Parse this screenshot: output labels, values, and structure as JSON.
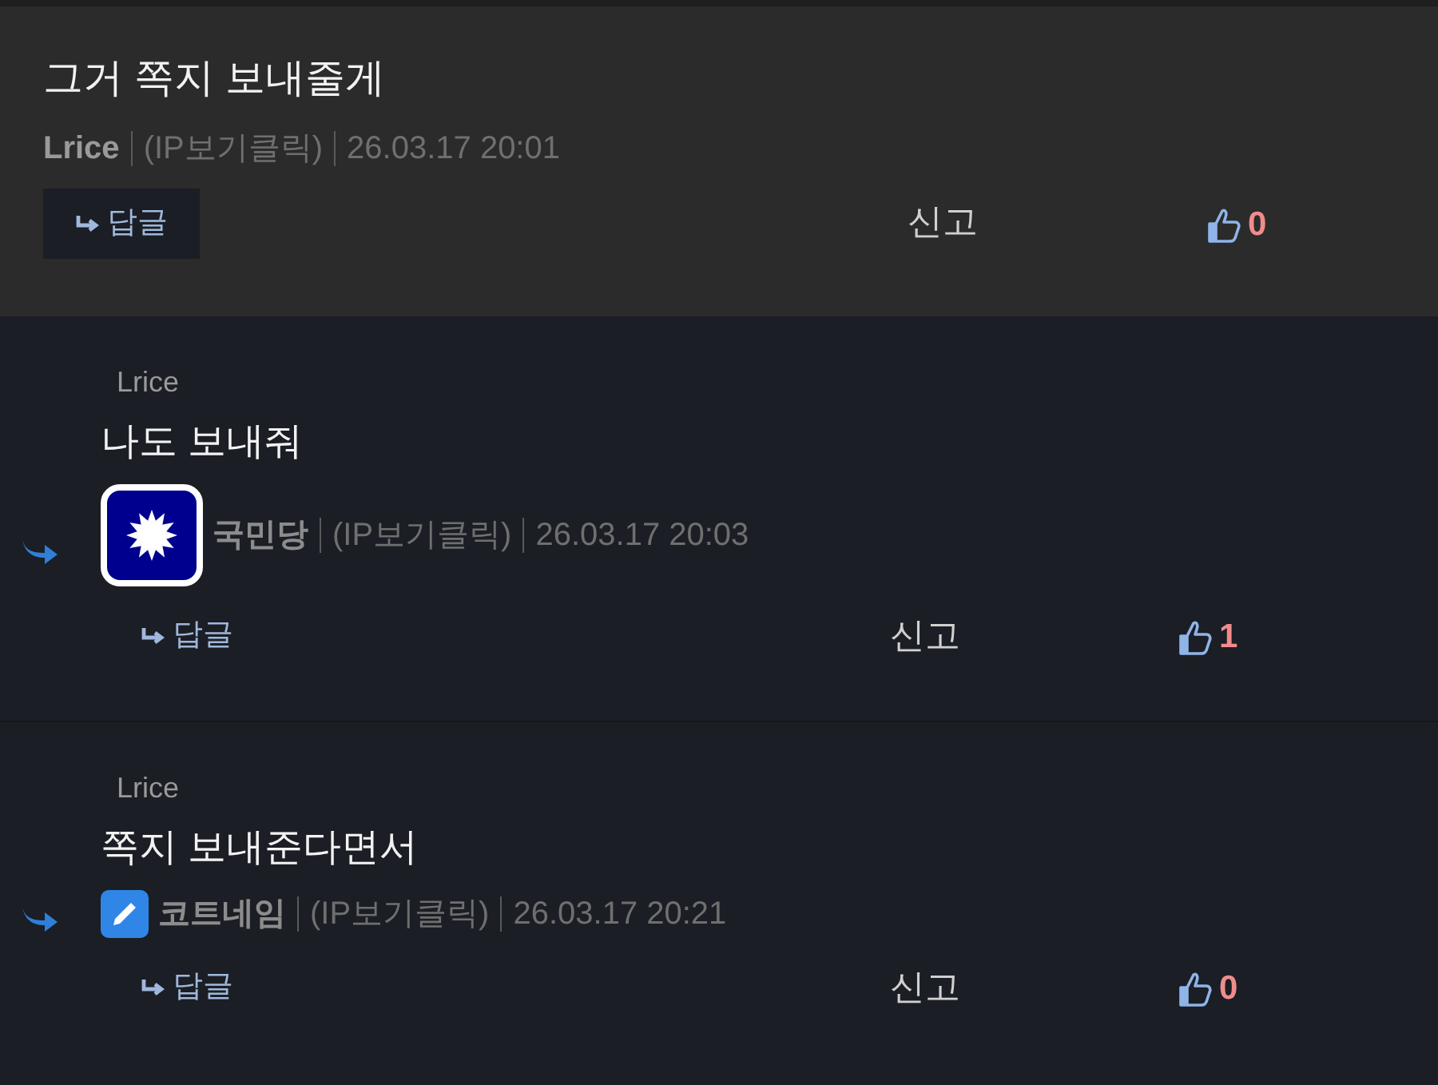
{
  "comment": {
    "text": "그거 쪽지 보내줄게",
    "author": "Lrice",
    "ip": "(IP보기클릭)",
    "date": "26.03.17 20:01",
    "reply": "답글",
    "report": "신고",
    "likes": "0"
  },
  "replies": [
    {
      "quote_name": "Lrice",
      "text": "나도 보내줘",
      "kind": "flag",
      "author": "국민당",
      "ip": "(IP보기클릭)",
      "date": "26.03.17 20:03",
      "reply": "답글",
      "report": "신고",
      "likes": "1"
    },
    {
      "quote_name": "Lrice",
      "text": "쪽지 보내준다면서",
      "kind": "pencil",
      "author": "코트네임",
      "ip": "(IP보기클릭)",
      "date": "26.03.17 20:21",
      "reply": "답글",
      "report": "신고",
      "likes": "0"
    }
  ]
}
